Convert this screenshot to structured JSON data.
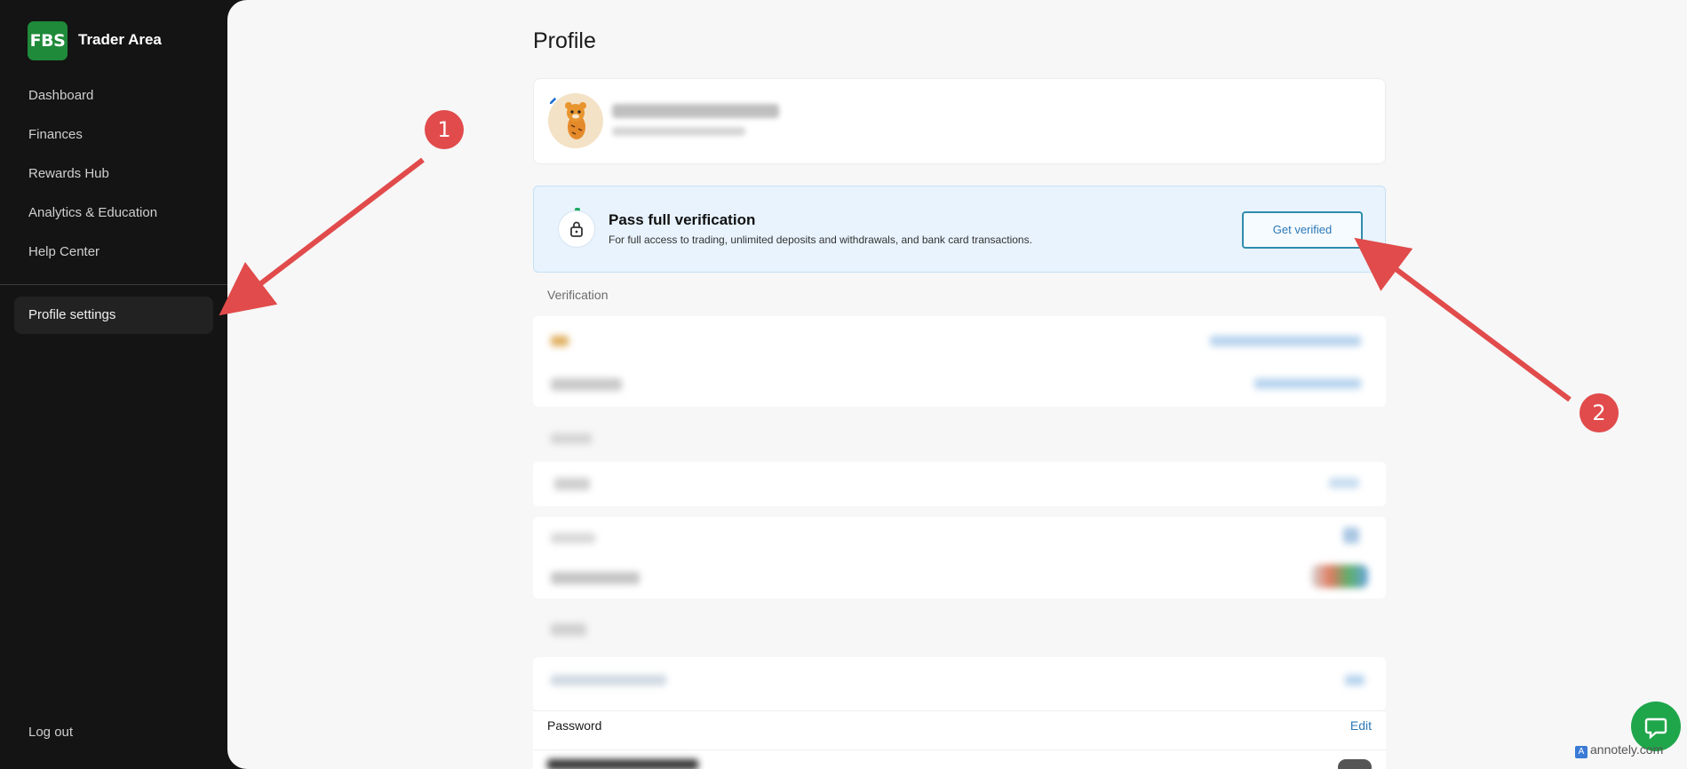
{
  "brand": {
    "logo_text": "FBS",
    "app_name": "Trader Area",
    "logo_color": "#1f8a3a"
  },
  "sidebar": {
    "items": [
      {
        "label": "Dashboard"
      },
      {
        "label": "Finances"
      },
      {
        "label": "Rewards Hub"
      },
      {
        "label": "Analytics & Education"
      },
      {
        "label": "Help Center"
      }
    ],
    "active_item": "Profile settings",
    "logout": "Log out"
  },
  "page": {
    "title": "Profile"
  },
  "verification_banner": {
    "title": "Pass full verification",
    "subtitle": "For full access to trading, unlimited deposits and withdrawals, and bank card transactions.",
    "button": "Get verified"
  },
  "sections": {
    "verification_label": "Verification"
  },
  "security": {
    "password_label": "Password",
    "password_action": "Edit"
  },
  "annotations": {
    "marker_1": "1",
    "marker_2": "2",
    "arrow_color": "#e14b4b"
  },
  "watermark": {
    "badge": "A",
    "text": "annotely.com"
  },
  "chat": {
    "icon": "chat-bubble-icon"
  }
}
